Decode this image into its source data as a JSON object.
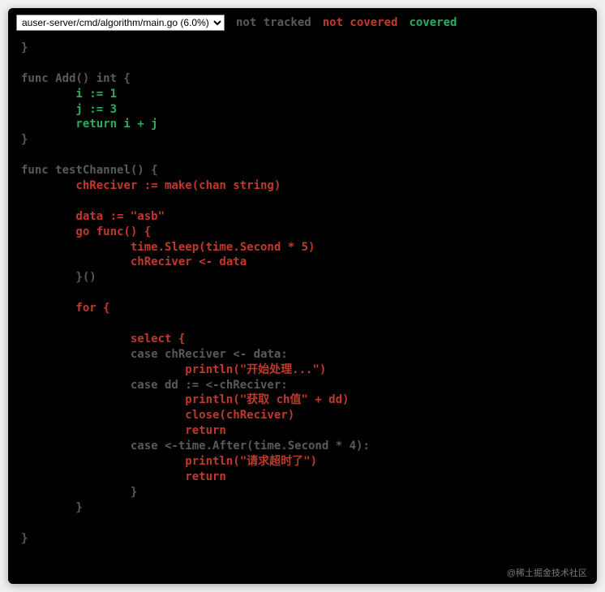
{
  "topbar": {
    "select_value": "auser-server/cmd/algorithm/main.go (6.0%)",
    "legend_not_tracked": "not tracked",
    "legend_not_covered": "not covered",
    "legend_covered": "covered"
  },
  "code": {
    "lines": [
      {
        "cls": "nt",
        "text": "}"
      },
      {
        "cls": "nt",
        "text": ""
      },
      {
        "cls": "nt",
        "text": "func Add() int {"
      },
      {
        "cls": "cv",
        "text": "        i := 1"
      },
      {
        "cls": "cv",
        "text": "        j := 3"
      },
      {
        "cls": "cv",
        "text": "        return i + j"
      },
      {
        "cls": "nt",
        "text": "}"
      },
      {
        "cls": "nt",
        "text": ""
      },
      {
        "cls": "nt",
        "text": "func testChannel() {"
      },
      {
        "cls": "nc",
        "text": "        chReciver := make(chan string)"
      },
      {
        "cls": "nc",
        "text": ""
      },
      {
        "cls": "nc",
        "text": "        data := \"asb\""
      },
      {
        "cls": "nc",
        "text": "        go func() {"
      },
      {
        "cls": "nc",
        "text": "                time.Sleep(time.Second * 5)"
      },
      {
        "cls": "nc",
        "text": "                chReciver <- data"
      },
      {
        "cls": "nt",
        "text": "        }()"
      },
      {
        "cls": "nt",
        "text": ""
      },
      {
        "cls": "nc",
        "text": "        for {"
      },
      {
        "cls": "nc",
        "text": ""
      },
      {
        "cls": "nc",
        "text": "                select {"
      },
      {
        "cls": "nt",
        "text": "                case chReciver <- data:"
      },
      {
        "cls": "nc",
        "text": "                        println(\"开始处理...\")"
      },
      {
        "cls": "nt",
        "text": "                case dd := <-chReciver:"
      },
      {
        "cls": "nc",
        "text": "                        println(\"获取 ch值\" + dd)"
      },
      {
        "cls": "nc",
        "text": "                        close(chReciver)"
      },
      {
        "cls": "nc",
        "text": "                        return"
      },
      {
        "cls": "nt",
        "text": "                case <-time.After(time.Second * 4):"
      },
      {
        "cls": "nc",
        "text": "                        println(\"请求超时了\")"
      },
      {
        "cls": "nc",
        "text": "                        return"
      },
      {
        "cls": "nt",
        "text": "                }"
      },
      {
        "cls": "nt",
        "text": "        }"
      },
      {
        "cls": "nt",
        "text": ""
      },
      {
        "cls": "nt",
        "text": "}"
      }
    ]
  },
  "watermark": "@稀土掘金技术社区"
}
